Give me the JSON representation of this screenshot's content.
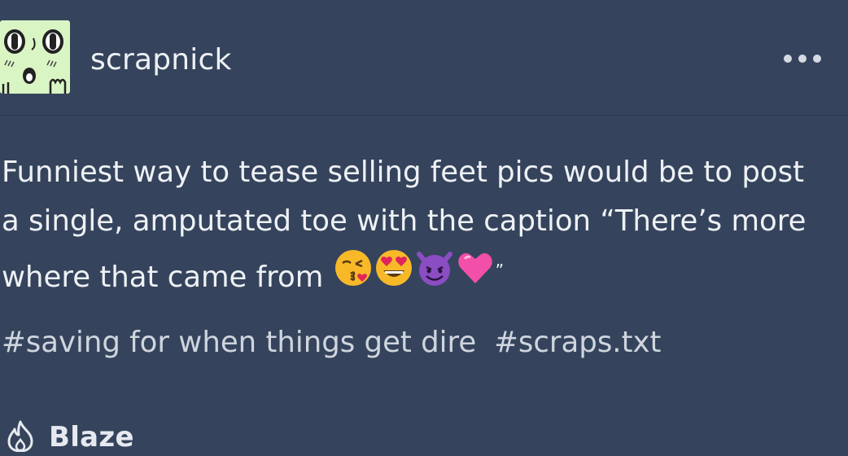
{
  "post": {
    "username": "scrapnick",
    "text_line1": "Funniest way to tease selling feet pics would be to post",
    "text_line2": "a single, amputated toe with the caption “There’s more",
    "text_line3_prefix": "where that came from ",
    "text_line3_suffix": "”",
    "emojis": [
      "kissing-heart-emoji",
      "heart-eyes-emoji",
      "smiling-imp-emoji",
      "pink-heart-emoji"
    ],
    "tags": [
      "#saving for when things get dire",
      "#scraps.txt"
    ],
    "blaze_label": "Blaze"
  },
  "icons": {
    "menu": "more-horizontal-icon",
    "blaze": "flame-icon"
  },
  "colors": {
    "background": "#35445c",
    "text": "#eef1f5",
    "avatar_bg": "#d9f5c4"
  }
}
